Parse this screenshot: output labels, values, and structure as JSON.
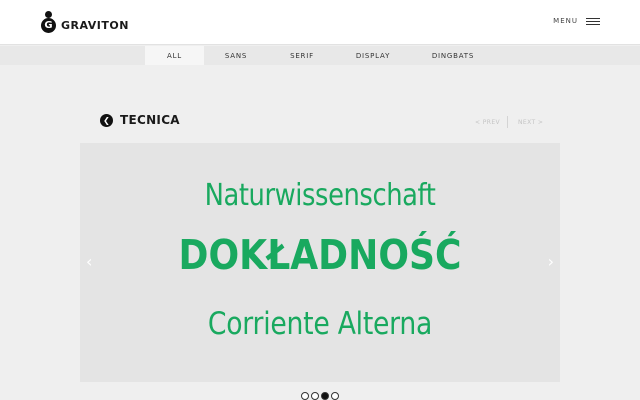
{
  "header": {
    "logo_glyph": "G",
    "brand": "GRAVITON",
    "menu_label": "MENU"
  },
  "filters": [
    {
      "label": "ALL",
      "active": true
    },
    {
      "label": "SANS",
      "active": false
    },
    {
      "label": "SERIF",
      "active": false
    },
    {
      "label": "DISPLAY",
      "active": false
    },
    {
      "label": "DINGBATS",
      "active": false
    }
  ],
  "font_page": {
    "back_icon": "chevron-left-icon",
    "title": "TECNICA",
    "prev_label": "< PREV",
    "next_label": "NEXT >"
  },
  "specimen": {
    "accent_color": "#19a95f",
    "lines": [
      "Naturwissenschaft",
      "DOKŁADNOŚĆ",
      "Corriente Alterna"
    ],
    "left_arrow": "‹",
    "right_arrow": "›"
  },
  "pagination": {
    "count": 4,
    "current": 3
  }
}
